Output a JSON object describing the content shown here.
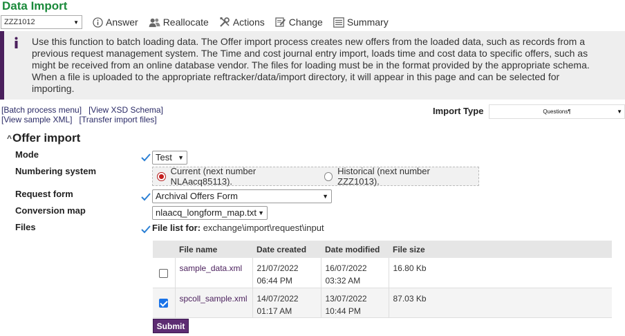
{
  "page": {
    "title": "Data Import"
  },
  "toolbar": {
    "request_select": "ZZZ1012",
    "items": [
      {
        "label": "Answer",
        "icon": "info-circle-icon"
      },
      {
        "label": "Reallocate",
        "icon": "users-icon"
      },
      {
        "label": "Actions",
        "icon": "tools-icon"
      },
      {
        "label": "Change",
        "icon": "edit-icon"
      },
      {
        "label": "Summary",
        "icon": "list-icon"
      }
    ]
  },
  "info": {
    "text": "Use this function to batch loading data. The Offer import process creates new offers from the loaded data, such as records from a\nprevious request management system. The Time and cost journal entry import, loads time and cost data to specific offers, such as\nmight be received from an online database vendor. The files for loading must be in the format provided by the appropriate schema.\nWhen a file is uploaded to the appropriate reftracker/data/import directory, it will appear in this page and can be selected for\nimporting."
  },
  "links": {
    "batch_menu": "[Batch process menu]",
    "xsd_schema": "[View XSD Schema]",
    "sample_xml": "[View sample XML]",
    "transfer": "[Transfer import files]"
  },
  "import_type": {
    "label": "Import Type",
    "value": "Questions¶"
  },
  "section": {
    "title": "Offer import"
  },
  "form": {
    "mode": {
      "label": "Mode",
      "value": "Test"
    },
    "numbering": {
      "label": "Numbering system",
      "current": "Current (next number NLAacq85113).",
      "historical": "Historical (next number ZZZ1013).",
      "selected": "current"
    },
    "request_form": {
      "label": "Request form",
      "value": "Archival Offers Form"
    },
    "conversion_map": {
      "label": "Conversion map",
      "value": "nlaacq_longform_map.txt"
    },
    "files": {
      "label": "Files",
      "list_prefix": "File list for:",
      "path": "exchange\\import\\request\\input"
    }
  },
  "table": {
    "headers": [
      "File name",
      "Date created",
      "Date modified",
      "File size"
    ],
    "rows": [
      {
        "checked": false,
        "name": "sample_data.xml",
        "created_date": "21/07/2022",
        "created_time": "06:44 PM",
        "modified_date": "16/07/2022",
        "modified_time": "03:32 AM",
        "size": "16.80 Kb"
      },
      {
        "checked": true,
        "name": "spcoll_sample.xml",
        "created_date": "14/07/2022",
        "created_time": "01:17 AM",
        "modified_date": "13/07/2022",
        "modified_time": "10:44 PM",
        "size": "87.03 Kb"
      }
    ]
  },
  "submit_label": "Submit",
  "colors": {
    "title_green": "#1a8a3a",
    "accent_purple": "#4a1f5c",
    "check_blue": "#1a73e8"
  }
}
